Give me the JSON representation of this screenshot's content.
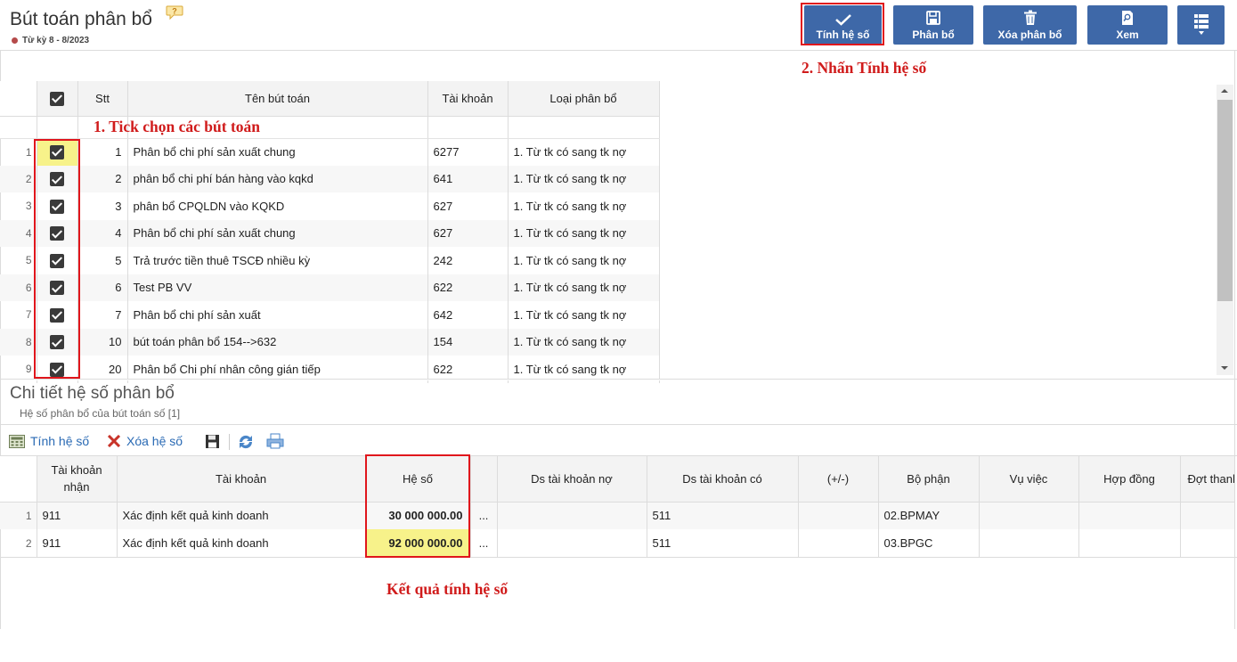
{
  "header": {
    "title": "Bút toán phân bổ",
    "period": "Từ kỳ 8 - 8/2023"
  },
  "toolbar": [
    {
      "label": "Tính hệ số",
      "icon": "check-icon"
    },
    {
      "label": "Phân bổ",
      "icon": "save-icon"
    },
    {
      "label": "Xóa phân bổ",
      "icon": "trash-icon"
    },
    {
      "label": "Xem",
      "icon": "search-doc-icon"
    },
    {
      "label": "",
      "icon": "menu-list-icon"
    }
  ],
  "annotations": {
    "step1": "1. Tick chọn các bút toán",
    "step2": "2. Nhấn Tính hệ số",
    "result": "Kết quả tính hệ số"
  },
  "entries_table": {
    "columns": [
      "Stt",
      "Tên bút toán",
      "Tài khoản",
      "Loại phân bổ"
    ],
    "rows": [
      {
        "row": "1",
        "stt": "1",
        "name": "Phân bổ chi phí sản xuất chung",
        "account": "6277",
        "type": "1. Từ tk có sang tk nợ"
      },
      {
        "row": "2",
        "stt": "2",
        "name": "phân bổ chi phí bán hàng vào kqkd",
        "account": "641",
        "type": "1. Từ tk có sang tk nợ"
      },
      {
        "row": "3",
        "stt": "3",
        "name": "phân bổ CPQLDN vào KQKD",
        "account": "627",
        "type": "1. Từ tk có sang tk nợ"
      },
      {
        "row": "4",
        "stt": "4",
        "name": "Phân bổ chi phí sản xuất chung",
        "account": "627",
        "type": "1. Từ tk có sang tk nợ"
      },
      {
        "row": "5",
        "stt": "5",
        "name": "Trả trước tiền thuê TSCĐ nhiều kỳ",
        "account": "242",
        "type": "1. Từ tk có sang tk nợ"
      },
      {
        "row": "6",
        "stt": "6",
        "name": "Test PB VV",
        "account": "622",
        "type": "1. Từ tk có sang tk nợ"
      },
      {
        "row": "7",
        "stt": "7",
        "name": "Phân bổ chi phí sản xuất",
        "account": "642",
        "type": "1. Từ tk có sang tk nợ"
      },
      {
        "row": "8",
        "stt": "10",
        "name": "bút toán phân bổ 154-->632",
        "account": "154",
        "type": "1. Từ tk có sang tk nợ"
      },
      {
        "row": "9",
        "stt": "20",
        "name": "Phân bổ Chi phí nhân công gián tiếp",
        "account": "622",
        "type": "1. Từ tk có sang tk nợ"
      }
    ]
  },
  "detail": {
    "title": "Chi tiết hệ số phân bổ",
    "subtitle": "Hệ số phân bổ của bút toán số [1]",
    "tools": {
      "calc": "Tính hệ số",
      "delete": "Xóa hệ số"
    },
    "columns": {
      "recv_account": "Tài khoản nhận",
      "account": "Tài khoản",
      "coef": "Hệ số",
      "debit_list": "Ds tài khoản nợ",
      "credit_list": "Ds tài khoản có",
      "plusminus": "(+/-)",
      "dept": "Bộ phận",
      "case": "Vụ việc",
      "contract": "Hợp đồng",
      "batch": "Đợt thanh"
    },
    "rows": [
      {
        "row": "1",
        "recv": "911",
        "account": "Xác định kết quả kinh doanh",
        "coef": "30 000 000.00",
        "more": "...",
        "debit": "",
        "credit": "511",
        "pm": "",
        "dept": "02.BPMAY"
      },
      {
        "row": "2",
        "recv": "911",
        "account": "Xác định kết quả kinh doanh",
        "coef": "92 000 000.00",
        "more": "...",
        "debit": "",
        "credit": "511",
        "pm": "",
        "dept": "03.BPGC"
      }
    ]
  },
  "colors": {
    "toolbar_button": "#3e68a8",
    "highlight_red": "#e0161c",
    "highlight_yellow": "#f7f28a"
  }
}
